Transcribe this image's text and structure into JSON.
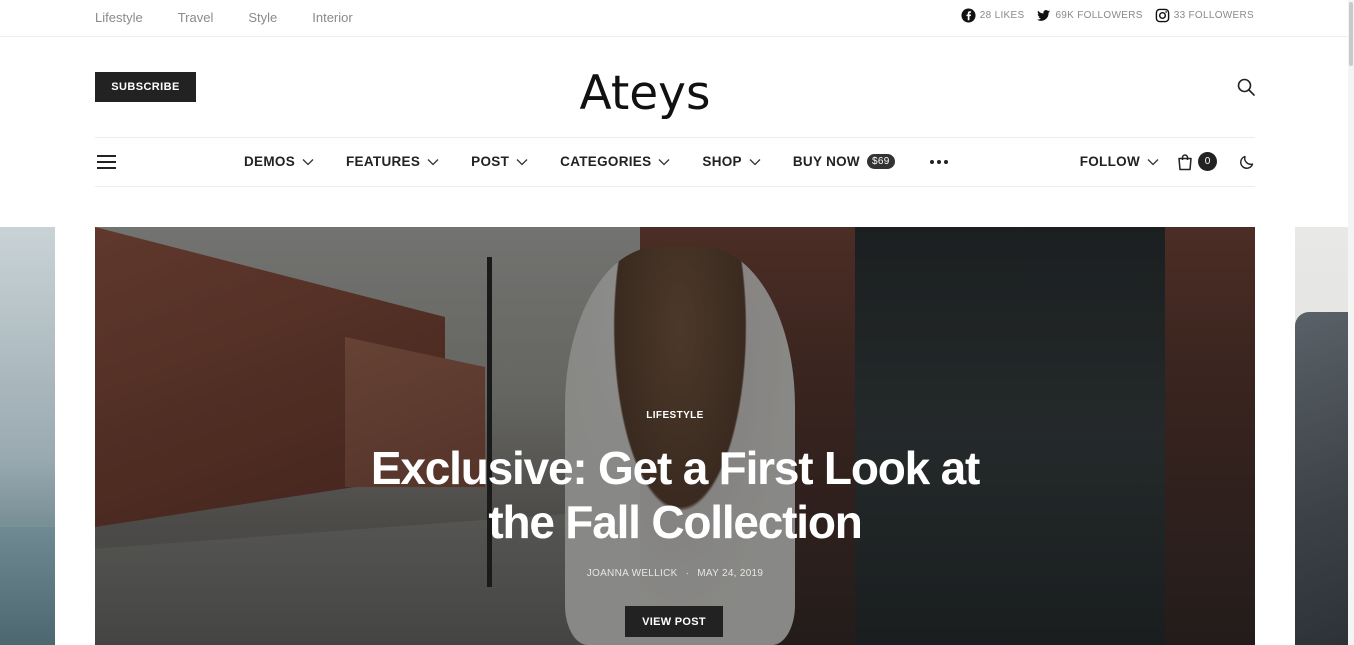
{
  "topbar": {
    "links": [
      "Lifestyle",
      "Travel",
      "Style",
      "Interior"
    ],
    "social": [
      {
        "icon": "facebook-icon",
        "label": "28 LIKES"
      },
      {
        "icon": "twitter-icon",
        "label": "69K FOLLOWERS"
      },
      {
        "icon": "instagram-icon",
        "label": "33 FOLLOWERS"
      }
    ]
  },
  "header": {
    "subscribe_label": "SUBSCRIBE",
    "logo": "Ateys"
  },
  "nav": {
    "items": [
      {
        "label": "DEMOS"
      },
      {
        "label": "FEATURES"
      },
      {
        "label": "POST"
      },
      {
        "label": "CATEGORIES"
      },
      {
        "label": "SHOP"
      },
      {
        "label": "BUY NOW",
        "badge": "$69"
      }
    ],
    "follow_label": "FOLLOW",
    "cart_count": "0"
  },
  "hero": {
    "category": "LIFESTYLE",
    "title": "Exclusive: Get a First Look at the Fall Collection",
    "author": "JOANNA WELLICK",
    "separator": "·",
    "date": "MAY 24, 2019",
    "button_label": "VIEW POST"
  },
  "colors": {
    "dark": "#222222",
    "muted": "#8a8a8a",
    "border": "#ececec"
  }
}
